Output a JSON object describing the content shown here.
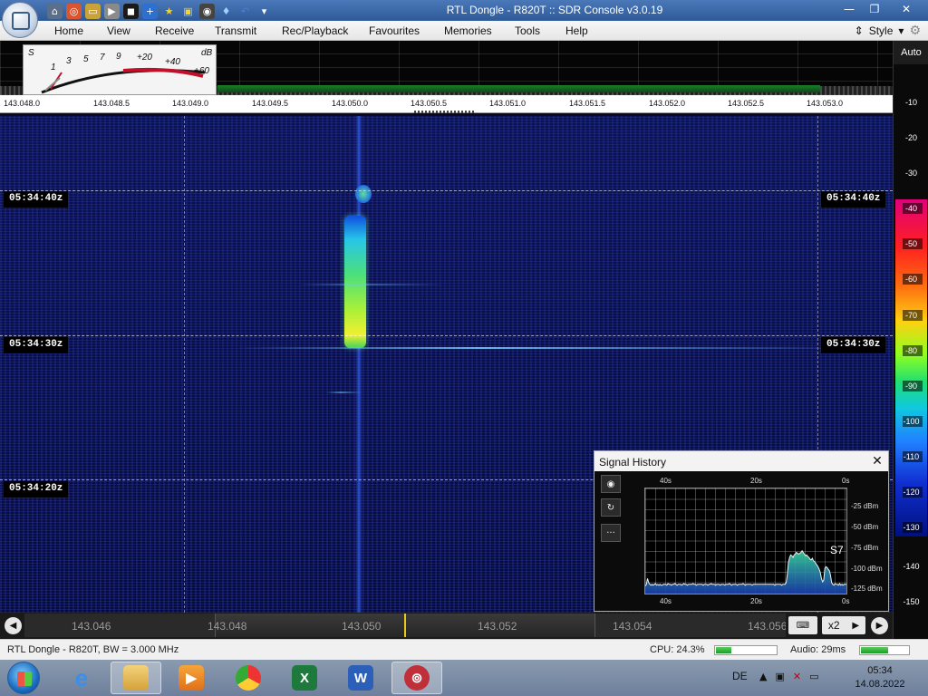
{
  "window": {
    "title": "RTL Dongle - R820T :: SDR Console v3.0.19"
  },
  "menu": {
    "items": [
      "Home",
      "View",
      "Receive",
      "Transmit",
      "Rec/Playback",
      "Favourites",
      "Memories",
      "Tools",
      "Help"
    ],
    "style_label": "Style"
  },
  "smeter": {
    "s_label": "S",
    "db_label": "dB",
    "s_scale": [
      "1",
      "3",
      "5",
      "7",
      "9"
    ],
    "plus_scale": [
      "+20",
      "+40",
      "+60"
    ]
  },
  "frequency_scale": [
    "143.048.0",
    "143.048.5",
    "143.049.0",
    "143.049.5",
    "143.050.0",
    "143.050.5",
    "143.051.0",
    "143.051.5",
    "143.052.0",
    "143.052.5",
    "143.053.0"
  ],
  "waterfall": {
    "timestamps": [
      "05:34:40z",
      "05:34:30z",
      "05:34:20z"
    ]
  },
  "db_scale": {
    "auto_label": "Auto",
    "labels": [
      "-10",
      "-20",
      "-30",
      "-40",
      "-50",
      "-60",
      "-70",
      "-80",
      "-90",
      "-100",
      "-110",
      "-120",
      "-130",
      "-140",
      "-150"
    ],
    "colors": {
      "top": "#e0007a",
      "mid": "#90ff20",
      "bottom": "#001080"
    }
  },
  "overview": {
    "labels": [
      "143.046",
      "143.048",
      "143.050",
      "143.052",
      "143.054",
      "143.056"
    ],
    "zoom_label": "x2"
  },
  "signal_history": {
    "title": "Signal History",
    "close_icon": "✕",
    "top_labels": [
      "40s",
      "20s",
      "0s"
    ],
    "bottom_labels": [
      "40s",
      "20s",
      "0s"
    ],
    "y_labels": [
      "-25 dBm",
      "-50 dBm",
      "-75 dBm",
      "-100 dBm",
      "-125 dBm"
    ],
    "s_reading": "S7",
    "chart_data": {
      "type": "line",
      "xlabel": "",
      "ylabel": "",
      "x_range": [
        "40s",
        "0s"
      ],
      "ylim": [
        -135,
        -10
      ],
      "series": [
        {
          "values": [
            -126,
            -124,
            -117,
            -122,
            -124,
            -125,
            -124,
            -125,
            -124,
            -123,
            -125,
            -124,
            -125,
            -124,
            -125,
            -125,
            -124,
            -124,
            -124,
            -125,
            -123,
            -124,
            -124,
            -125,
            -124,
            -124,
            -123,
            -124,
            -125,
            -124,
            -124,
            -124,
            -125,
            -124,
            -123,
            -124,
            -124,
            -125,
            -124,
            -124,
            -124,
            -124,
            -123,
            -124,
            -124,
            -125,
            -124,
            -124,
            -124,
            -124,
            -124,
            -125,
            -124,
            -124,
            -124,
            -125,
            -124,
            -124,
            -123,
            -124,
            -124,
            -124,
            -125,
            -124,
            -124,
            -124,
            -125,
            -124,
            -124,
            -124,
            -125,
            -124,
            -124,
            -124,
            -123,
            -124,
            -125,
            -124,
            -124,
            -124,
            -124,
            -125,
            -124,
            -124,
            -124,
            -124,
            -123,
            -124,
            -125,
            -124,
            -124,
            -124,
            -124,
            -124,
            -125,
            -124,
            -124,
            -124,
            -124,
            -124,
            -124,
            -124,
            -124,
            -124,
            -124,
            -124,
            -124,
            -124,
            -124,
            -124,
            -124,
            -124,
            -124,
            -124,
            -125,
            -124,
            -124,
            -124,
            -124,
            -124,
            -125,
            -124,
            -124,
            -124,
            -122,
            -112,
            -98,
            -92,
            -89,
            -90,
            -92,
            -89,
            -88,
            -86,
            -87,
            -88,
            -87,
            -86,
            -84,
            -86,
            -88,
            -90,
            -89,
            -91,
            -92,
            -94,
            -95,
            -93,
            -96,
            -97,
            -99,
            -101,
            -103,
            -106,
            -110,
            -117,
            -121,
            -119,
            -105,
            -103,
            -104,
            -106,
            -108,
            -113,
            -122,
            -124,
            -125,
            -123,
            -124,
            -124,
            -125,
            -123,
            -125,
            -124,
            -125,
            -124,
            -124,
            -124
          ]
        }
      ]
    }
  },
  "status": {
    "device": "RTL Dongle - R820T, BW = 3.000 MHz",
    "cpu": "CPU: 24.3%",
    "cpu_level": 0.243,
    "audio": "Audio: 29ms",
    "audio_level": 0.55
  },
  "taskbar": {
    "language": "DE",
    "time": "05:34",
    "date": "14.08.2022",
    "apps": [
      "ie-icon",
      "explorer-icon",
      "media-player-icon",
      "chrome-icon",
      "excel-icon",
      "word-icon",
      "sdr-console-icon"
    ]
  }
}
